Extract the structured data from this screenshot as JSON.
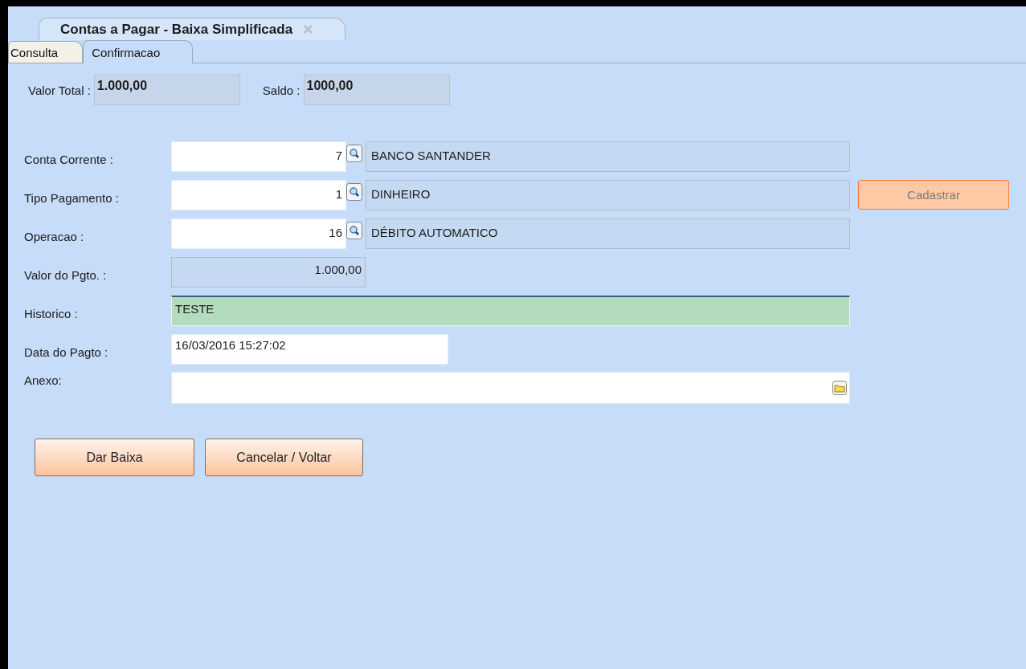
{
  "window": {
    "title": "Contas a Pagar - Baixa Simplificada"
  },
  "tabs": [
    {
      "label": "Consulta",
      "selected": false
    },
    {
      "label": "Confirmacao",
      "selected": true
    }
  ],
  "totals": [
    {
      "label": "Valor Total :",
      "value": "1.000,00"
    },
    {
      "label": "Saldo :",
      "value": "1000,00"
    }
  ],
  "fields": [
    {
      "kind": "lookup",
      "label": "Conta Corrente :",
      "code": "7",
      "description": "BANCO SANTANDER"
    },
    {
      "kind": "lookup",
      "label": "Tipo Pagamento :",
      "code": "1",
      "description": "DINHEIRO",
      "side_button": {
        "label": "Cadastrar",
        "disabled": true
      }
    },
    {
      "kind": "lookup",
      "label": "Operacao :",
      "code": "16",
      "description": "DÉBITO AUTOMATICO"
    },
    {
      "kind": "readonly",
      "label": "Valor do Pgto. :",
      "value": "1.000,00"
    },
    {
      "kind": "focused",
      "label": "Historico :",
      "value": "TESTE"
    },
    {
      "kind": "text",
      "label": "Data do Pagto :",
      "value": "16/03/2016 15:27:02"
    },
    {
      "kind": "file",
      "label": "Anexo:"
    }
  ],
  "buttons": [
    {
      "label": "Dar Baixa"
    },
    {
      "label": "Cancelar / Voltar"
    }
  ]
}
